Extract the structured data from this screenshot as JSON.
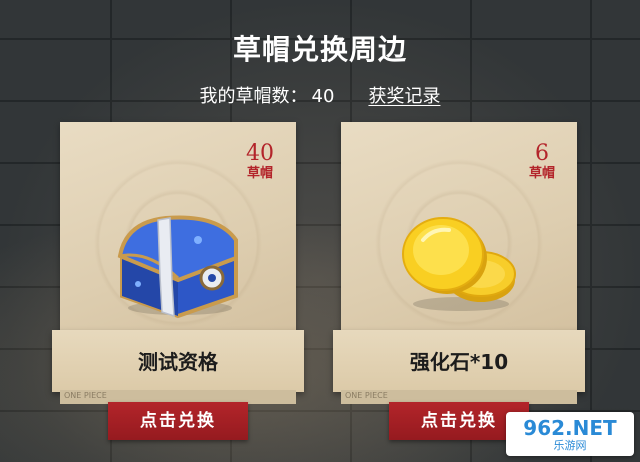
{
  "header": {
    "title": "草帽兑换周边",
    "count_label": "我的草帽数：",
    "count_value": "40",
    "record_link": "获奖记录"
  },
  "cards": [
    {
      "price": "40",
      "unit": "草帽",
      "name": "测试资格",
      "button": "点击兑换",
      "icon": "treasure-chest-icon",
      "strip_text": "ONE PIECE"
    },
    {
      "price": "6",
      "unit": "草帽",
      "name": "强化石*10",
      "button": "点击兑换",
      "icon": "gold-coins-icon",
      "strip_text": "ONE PIECE"
    }
  ],
  "watermark": {
    "label": "962.NET",
    "sub": "乐游网"
  },
  "colors": {
    "accent_red": "#b3242a",
    "paper": "#e7d9bd",
    "wall": "#3f4446"
  }
}
